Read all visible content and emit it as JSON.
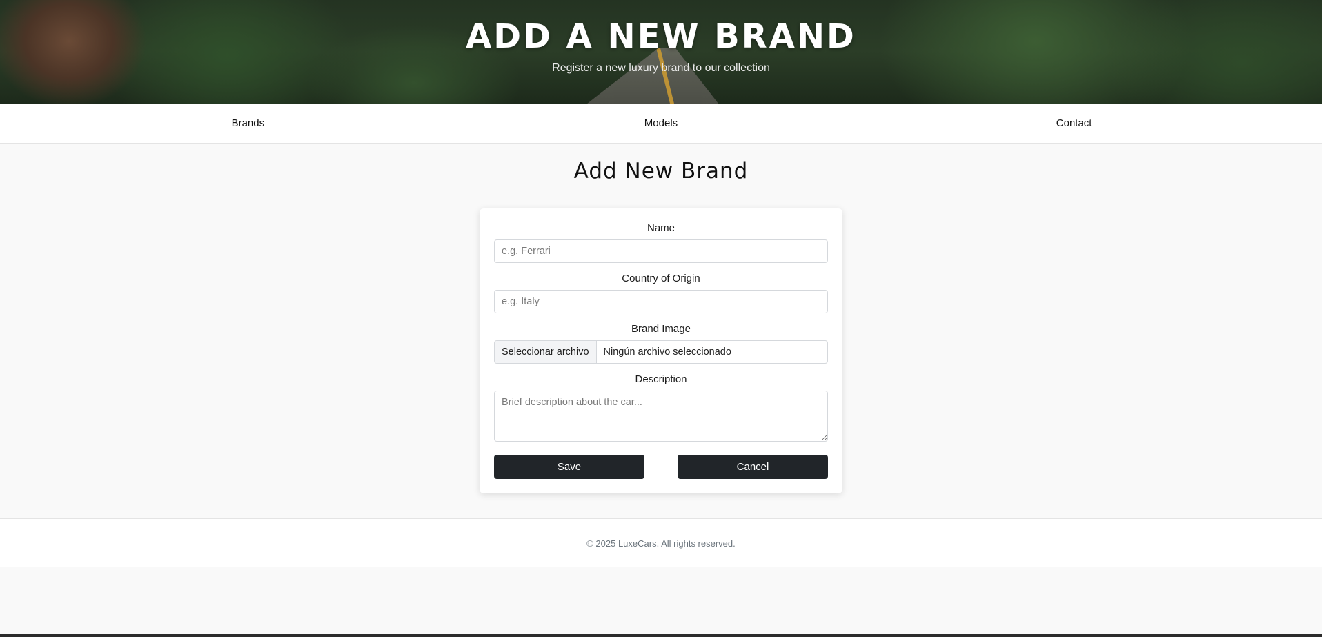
{
  "hero": {
    "title": "ADD A NEW BRAND",
    "subtitle": "Register a new luxury brand to our collection"
  },
  "nav": {
    "items": [
      {
        "label": "Brands"
      },
      {
        "label": "Models"
      },
      {
        "label": "Contact"
      }
    ]
  },
  "main": {
    "page_title": "Add New Brand",
    "form": {
      "name": {
        "label": "Name",
        "placeholder": "e.g. Ferrari",
        "value": ""
      },
      "country": {
        "label": "Country of Origin",
        "placeholder": "e.g. Italy",
        "value": ""
      },
      "image": {
        "label": "Brand Image",
        "button_label": "Seleccionar archivo",
        "file_status": "Ningún archivo seleccionado"
      },
      "description": {
        "label": "Description",
        "placeholder": "Brief description about the car...",
        "value": ""
      },
      "save_label": "Save",
      "cancel_label": "Cancel"
    }
  },
  "footer": {
    "copyright": "© 2025 LuxeCars. All rights reserved."
  },
  "colors": {
    "button_bg": "#212529",
    "page_bg": "#f9f9f9"
  }
}
